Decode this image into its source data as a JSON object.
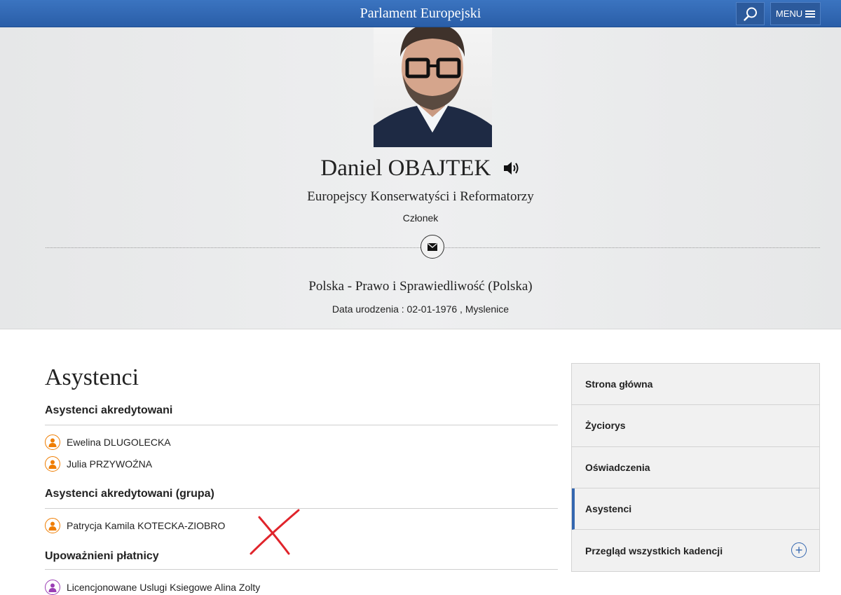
{
  "header": {
    "site_title": "Parlament Europejski",
    "menu_label": "MENU",
    "search_icon": "search-icon",
    "menu_icon": "hamburger-icon"
  },
  "profile": {
    "name": "Daniel OBAJTEK",
    "group": "Europejscy Konserwatyści i Reformatorzy",
    "role": "Członek",
    "country_party": "Polska - Prawo i Sprawiedliwość (Polska)",
    "birth": "Data urodzenia : 02-01-1976 , Myslenice"
  },
  "main": {
    "title": "Asystenci",
    "sections": [
      {
        "title": "Asystenci akredytowani",
        "people": [
          "Ewelina DLUGOLECKA",
          "Julia PRZYWOŹNA"
        ]
      },
      {
        "title": "Asystenci akredytowani (grupa)",
        "people": [
          "Patrycja Kamila KOTECKA-ZIOBRO"
        ]
      },
      {
        "title": "Upoważnieni płatnicy",
        "people": [
          "Licencjonowane Uslugi Ksiegowe Alina Zolty"
        ]
      }
    ]
  },
  "sidebar": {
    "items": [
      {
        "label": "Strona główna"
      },
      {
        "label": "Życiorys"
      },
      {
        "label": "Oświadczenia"
      },
      {
        "label": "Asystenci",
        "active": true
      },
      {
        "label": "Przegląd wszystkich kadencji"
      }
    ]
  },
  "colors": {
    "topbar": "#2f66b0",
    "accent": "#3467b0",
    "assistant_icon": "#ef7d00",
    "payer_icon": "#9b3fb5",
    "annotation": "#e0242b"
  }
}
